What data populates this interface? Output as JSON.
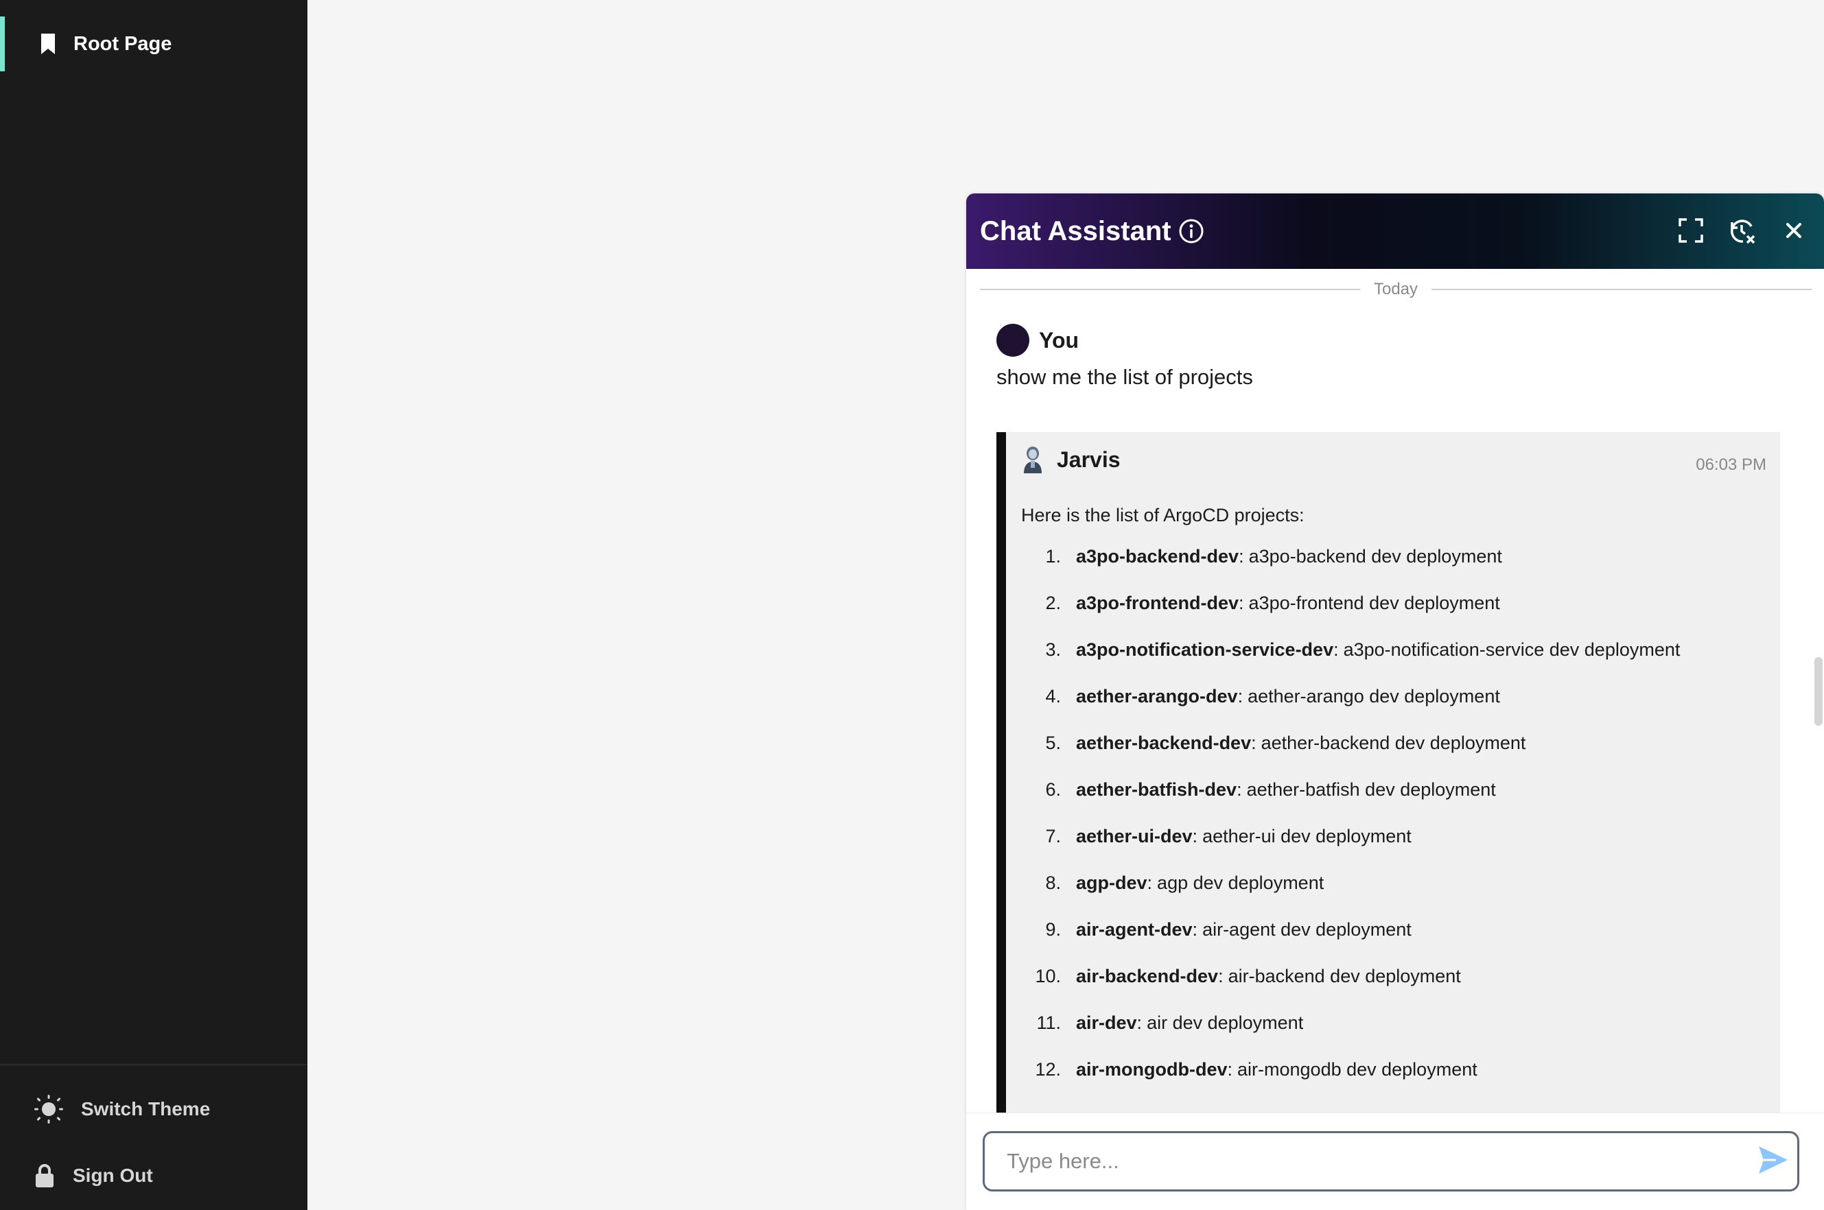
{
  "sidebar": {
    "nav_items": [
      {
        "label": "Root Page",
        "icon": "bookmark-icon"
      }
    ],
    "switch_theme_label": "Switch Theme",
    "sign_out_label": "Sign Out"
  },
  "chat": {
    "title": "Chat Assistant",
    "date_separator": "Today",
    "user_message": {
      "sender": "You",
      "text": "show me the list of projects"
    },
    "bot_message": {
      "sender": "Jarvis",
      "time": "06:03 PM",
      "intro": "Here is the list of ArgoCD projects:",
      "items": [
        {
          "num": "1.",
          "name": "a3po-backend-dev",
          "desc": "a3po-backend dev deployment"
        },
        {
          "num": "2.",
          "name": "a3po-frontend-dev",
          "desc": "a3po-frontend dev deployment"
        },
        {
          "num": "3.",
          "name": "a3po-notification-service-dev",
          "desc": "a3po-notification-service dev deployment"
        },
        {
          "num": "4.",
          "name": "aether-arango-dev",
          "desc": "aether-arango dev deployment"
        },
        {
          "num": "5.",
          "name": "aether-backend-dev",
          "desc": "aether-backend dev deployment"
        },
        {
          "num": "6.",
          "name": "aether-batfish-dev",
          "desc": "aether-batfish dev deployment"
        },
        {
          "num": "7.",
          "name": "aether-ui-dev",
          "desc": "aether-ui dev deployment"
        },
        {
          "num": "8.",
          "name": "agp-dev",
          "desc": "agp dev deployment"
        },
        {
          "num": "9.",
          "name": "air-agent-dev",
          "desc": "air-agent dev deployment"
        },
        {
          "num": "10.",
          "name": "air-backend-dev",
          "desc": "air-backend dev deployment"
        },
        {
          "num": "11.",
          "name": "air-dev",
          "desc": "air dev deployment"
        },
        {
          "num": "12.",
          "name": "air-mongodb-dev",
          "desc": "air-mongodb dev deployment"
        }
      ]
    },
    "input": {
      "placeholder": "Type here...",
      "value": ""
    }
  },
  "colors": {
    "sidebar_bg": "#1b1b1b",
    "active_accent": "#7de3d1",
    "send_icon": "#8ec5ff"
  }
}
